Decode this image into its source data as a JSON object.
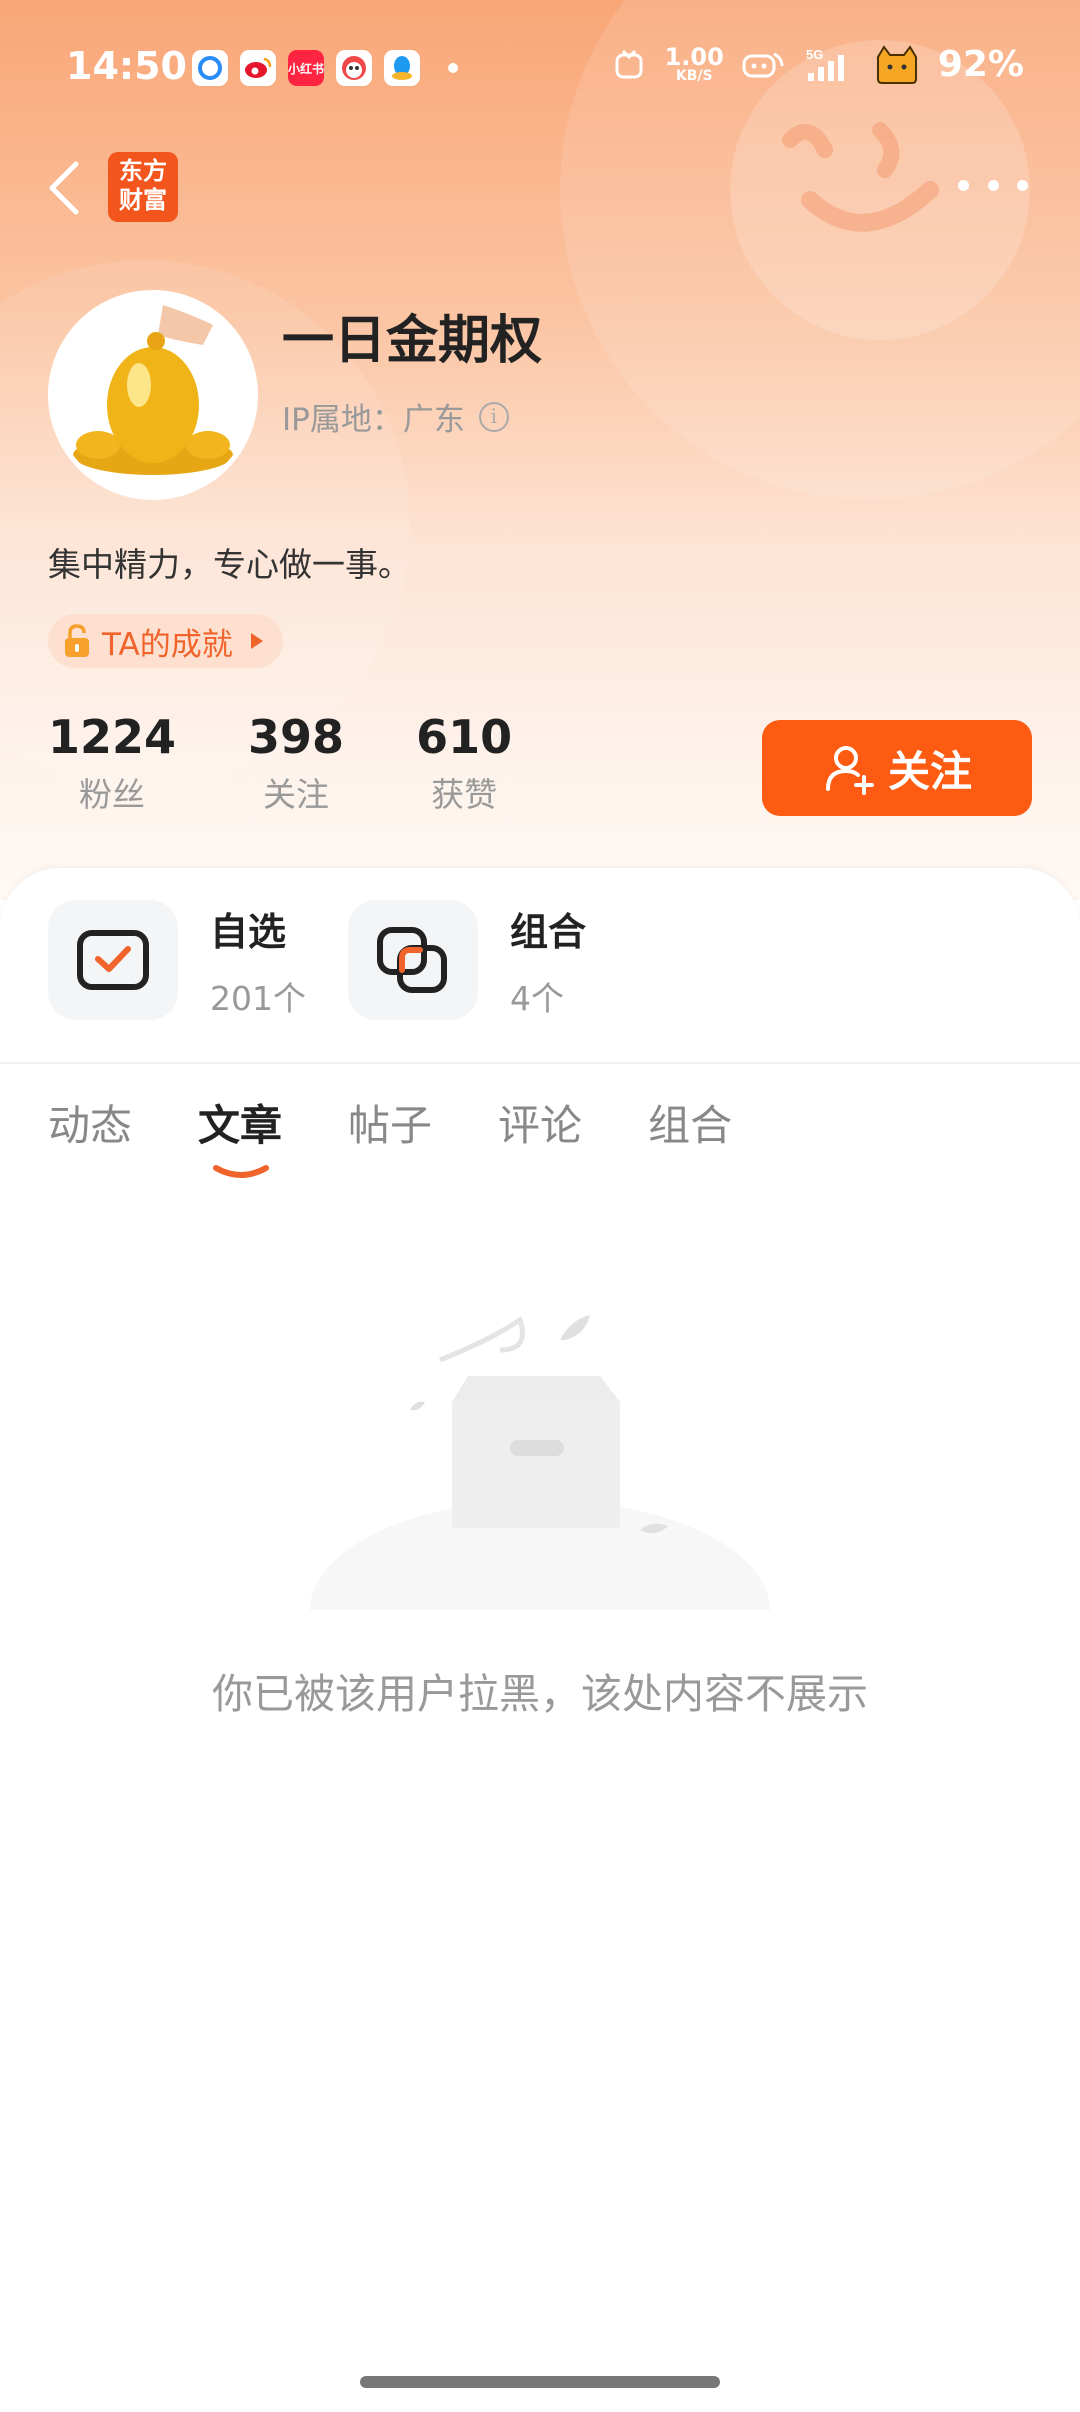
{
  "status_bar": {
    "time": "14:50",
    "speed_value": "1.00",
    "speed_unit": "KB/S",
    "battery": "92%"
  },
  "nav": {
    "logo_line1": "东方",
    "logo_line2": "财富"
  },
  "profile": {
    "username": "一日金期权",
    "ip_location": "IP属地：广东",
    "bio": "集中精力，专心做一事。",
    "achievement_label": "TA的成就"
  },
  "stats": [
    {
      "value": "1224",
      "label": "粉丝"
    },
    {
      "value": "398",
      "label": "关注"
    },
    {
      "value": "610",
      "label": "获赞"
    }
  ],
  "follow_button": "关注",
  "entries": {
    "watchlist": {
      "title": "自选",
      "count": "201个"
    },
    "portfolio": {
      "title": "组合",
      "count": "4个"
    }
  },
  "tabs": [
    "动态",
    "文章",
    "帖子",
    "评论",
    "组合"
  ],
  "active_tab": "文章",
  "empty_message": "你已被该用户拉黑，该处内容不展示",
  "colors": {
    "accent": "#fd5b11",
    "brand": "#f2561d"
  }
}
